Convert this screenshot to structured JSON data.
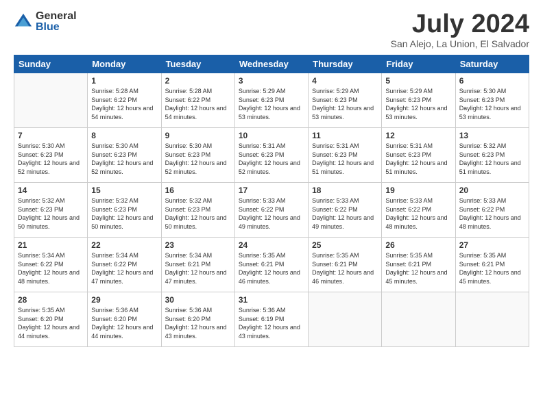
{
  "logo": {
    "general": "General",
    "blue": "Blue"
  },
  "title": "July 2024",
  "location": "San Alejo, La Union, El Salvador",
  "days_of_week": [
    "Sunday",
    "Monday",
    "Tuesday",
    "Wednesday",
    "Thursday",
    "Friday",
    "Saturday"
  ],
  "weeks": [
    [
      {
        "day": "",
        "sunrise": "",
        "sunset": "",
        "daylight": "",
        "empty": true
      },
      {
        "day": "1",
        "sunrise": "Sunrise: 5:28 AM",
        "sunset": "Sunset: 6:22 PM",
        "daylight": "Daylight: 12 hours and 54 minutes."
      },
      {
        "day": "2",
        "sunrise": "Sunrise: 5:28 AM",
        "sunset": "Sunset: 6:22 PM",
        "daylight": "Daylight: 12 hours and 54 minutes."
      },
      {
        "day": "3",
        "sunrise": "Sunrise: 5:29 AM",
        "sunset": "Sunset: 6:23 PM",
        "daylight": "Daylight: 12 hours and 53 minutes."
      },
      {
        "day": "4",
        "sunrise": "Sunrise: 5:29 AM",
        "sunset": "Sunset: 6:23 PM",
        "daylight": "Daylight: 12 hours and 53 minutes."
      },
      {
        "day": "5",
        "sunrise": "Sunrise: 5:29 AM",
        "sunset": "Sunset: 6:23 PM",
        "daylight": "Daylight: 12 hours and 53 minutes."
      },
      {
        "day": "6",
        "sunrise": "Sunrise: 5:30 AM",
        "sunset": "Sunset: 6:23 PM",
        "daylight": "Daylight: 12 hours and 53 minutes."
      }
    ],
    [
      {
        "day": "7",
        "sunrise": "Sunrise: 5:30 AM",
        "sunset": "Sunset: 6:23 PM",
        "daylight": "Daylight: 12 hours and 52 minutes."
      },
      {
        "day": "8",
        "sunrise": "Sunrise: 5:30 AM",
        "sunset": "Sunset: 6:23 PM",
        "daylight": "Daylight: 12 hours and 52 minutes."
      },
      {
        "day": "9",
        "sunrise": "Sunrise: 5:30 AM",
        "sunset": "Sunset: 6:23 PM",
        "daylight": "Daylight: 12 hours and 52 minutes."
      },
      {
        "day": "10",
        "sunrise": "Sunrise: 5:31 AM",
        "sunset": "Sunset: 6:23 PM",
        "daylight": "Daylight: 12 hours and 52 minutes."
      },
      {
        "day": "11",
        "sunrise": "Sunrise: 5:31 AM",
        "sunset": "Sunset: 6:23 PM",
        "daylight": "Daylight: 12 hours and 51 minutes."
      },
      {
        "day": "12",
        "sunrise": "Sunrise: 5:31 AM",
        "sunset": "Sunset: 6:23 PM",
        "daylight": "Daylight: 12 hours and 51 minutes."
      },
      {
        "day": "13",
        "sunrise": "Sunrise: 5:32 AM",
        "sunset": "Sunset: 6:23 PM",
        "daylight": "Daylight: 12 hours and 51 minutes."
      }
    ],
    [
      {
        "day": "14",
        "sunrise": "Sunrise: 5:32 AM",
        "sunset": "Sunset: 6:23 PM",
        "daylight": "Daylight: 12 hours and 50 minutes."
      },
      {
        "day": "15",
        "sunrise": "Sunrise: 5:32 AM",
        "sunset": "Sunset: 6:23 PM",
        "daylight": "Daylight: 12 hours and 50 minutes."
      },
      {
        "day": "16",
        "sunrise": "Sunrise: 5:32 AM",
        "sunset": "Sunset: 6:23 PM",
        "daylight": "Daylight: 12 hours and 50 minutes."
      },
      {
        "day": "17",
        "sunrise": "Sunrise: 5:33 AM",
        "sunset": "Sunset: 6:22 PM",
        "daylight": "Daylight: 12 hours and 49 minutes."
      },
      {
        "day": "18",
        "sunrise": "Sunrise: 5:33 AM",
        "sunset": "Sunset: 6:22 PM",
        "daylight": "Daylight: 12 hours and 49 minutes."
      },
      {
        "day": "19",
        "sunrise": "Sunrise: 5:33 AM",
        "sunset": "Sunset: 6:22 PM",
        "daylight": "Daylight: 12 hours and 48 minutes."
      },
      {
        "day": "20",
        "sunrise": "Sunrise: 5:33 AM",
        "sunset": "Sunset: 6:22 PM",
        "daylight": "Daylight: 12 hours and 48 minutes."
      }
    ],
    [
      {
        "day": "21",
        "sunrise": "Sunrise: 5:34 AM",
        "sunset": "Sunset: 6:22 PM",
        "daylight": "Daylight: 12 hours and 48 minutes."
      },
      {
        "day": "22",
        "sunrise": "Sunrise: 5:34 AM",
        "sunset": "Sunset: 6:22 PM",
        "daylight": "Daylight: 12 hours and 47 minutes."
      },
      {
        "day": "23",
        "sunrise": "Sunrise: 5:34 AM",
        "sunset": "Sunset: 6:21 PM",
        "daylight": "Daylight: 12 hours and 47 minutes."
      },
      {
        "day": "24",
        "sunrise": "Sunrise: 5:35 AM",
        "sunset": "Sunset: 6:21 PM",
        "daylight": "Daylight: 12 hours and 46 minutes."
      },
      {
        "day": "25",
        "sunrise": "Sunrise: 5:35 AM",
        "sunset": "Sunset: 6:21 PM",
        "daylight": "Daylight: 12 hours and 46 minutes."
      },
      {
        "day": "26",
        "sunrise": "Sunrise: 5:35 AM",
        "sunset": "Sunset: 6:21 PM",
        "daylight": "Daylight: 12 hours and 45 minutes."
      },
      {
        "day": "27",
        "sunrise": "Sunrise: 5:35 AM",
        "sunset": "Sunset: 6:21 PM",
        "daylight": "Daylight: 12 hours and 45 minutes."
      }
    ],
    [
      {
        "day": "28",
        "sunrise": "Sunrise: 5:35 AM",
        "sunset": "Sunset: 6:20 PM",
        "daylight": "Daylight: 12 hours and 44 minutes."
      },
      {
        "day": "29",
        "sunrise": "Sunrise: 5:36 AM",
        "sunset": "Sunset: 6:20 PM",
        "daylight": "Daylight: 12 hours and 44 minutes."
      },
      {
        "day": "30",
        "sunrise": "Sunrise: 5:36 AM",
        "sunset": "Sunset: 6:20 PM",
        "daylight": "Daylight: 12 hours and 43 minutes."
      },
      {
        "day": "31",
        "sunrise": "Sunrise: 5:36 AM",
        "sunset": "Sunset: 6:19 PM",
        "daylight": "Daylight: 12 hours and 43 minutes."
      },
      {
        "day": "",
        "sunrise": "",
        "sunset": "",
        "daylight": "",
        "empty": true
      },
      {
        "day": "",
        "sunrise": "",
        "sunset": "",
        "daylight": "",
        "empty": true
      },
      {
        "day": "",
        "sunrise": "",
        "sunset": "",
        "daylight": "",
        "empty": true
      }
    ]
  ]
}
